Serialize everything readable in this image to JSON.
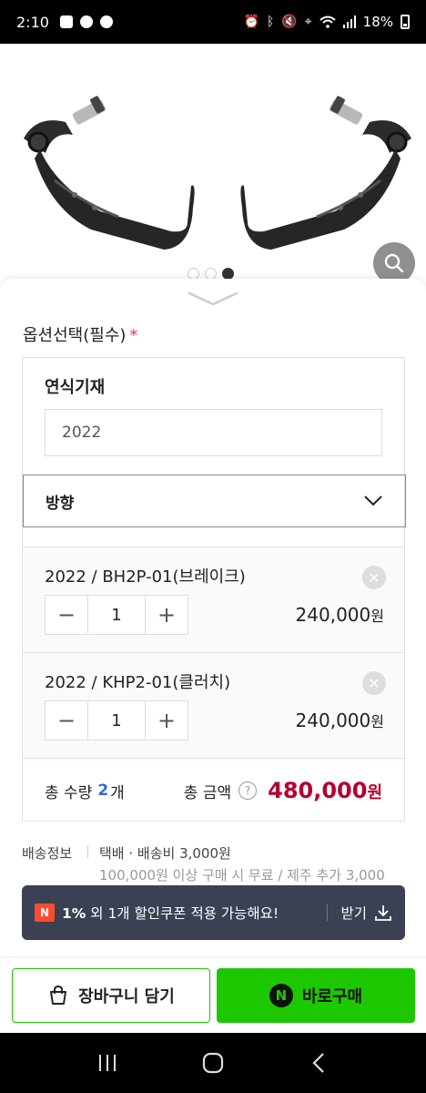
{
  "status_bar": {
    "time": "2:10",
    "battery": "18%",
    "icons": [
      "talk-icon",
      "chrome-icon",
      "app-icon",
      "alarm-icon",
      "bluetooth-icon",
      "mute-icon",
      "location-icon",
      "wifi-icon",
      "signal-icon",
      "battery-icon"
    ]
  },
  "gallery": {
    "dots": [
      false,
      false,
      true
    ],
    "zoom_icon": "search-icon"
  },
  "options": {
    "title": "옵션선택(필수)",
    "required_mark": "*",
    "year_label": "연식기재",
    "year_value": "2022",
    "direction_label": "방향"
  },
  "selected": [
    {
      "name": "2022 / BH2P-01(브레이크)",
      "qty": "1",
      "price": "240,000",
      "currency": "원"
    },
    {
      "name": "2022 / KHP2-01(클러치)",
      "qty": "1",
      "price": "240,000",
      "currency": "원"
    }
  ],
  "stepper": {
    "minus": "−",
    "plus": "+"
  },
  "total": {
    "qty_label": "총 수량",
    "qty_value": "2",
    "qty_unit": "개",
    "amount_label": "총 금액",
    "help": "?",
    "amount_value": "480,000",
    "currency": "원"
  },
  "shipping": {
    "label": "배송정보",
    "value": "택배 · 배송비 3,000원",
    "note": "100,000원 이상 구매 시 무료 / 제주 추가 3,000"
  },
  "coupon": {
    "badge": "N",
    "percent": "1%",
    "text": " 외 1개 할인쿠폰 적용 가능해요!",
    "get_label": "받기"
  },
  "actions": {
    "cart_label": "장바구니 담기",
    "buy_label": "바로구매",
    "npay_mark": "N"
  },
  "colors": {
    "accent_green": "#1ec800",
    "price_red": "#b5002f",
    "qty_blue": "#2e6dd8",
    "coupon_bg": "#3b4152"
  }
}
